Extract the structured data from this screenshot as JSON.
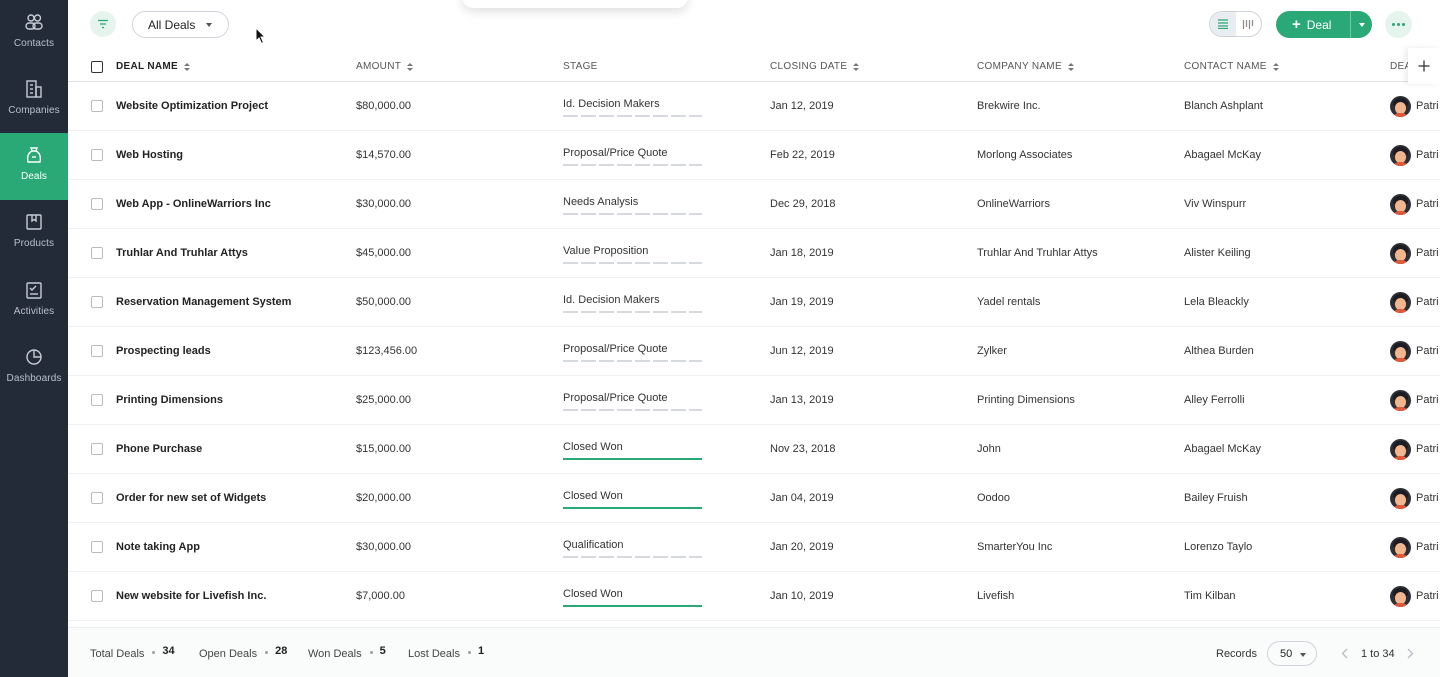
{
  "sidebar": {
    "items": [
      {
        "label": "Contacts",
        "icon": "contacts-icon",
        "active": false
      },
      {
        "label": "Companies",
        "icon": "companies-icon",
        "active": false
      },
      {
        "label": "Deals",
        "icon": "deals-icon",
        "active": true
      },
      {
        "label": "Products",
        "icon": "products-icon",
        "active": false
      },
      {
        "label": "Activities",
        "icon": "activities-icon",
        "active": false
      },
      {
        "label": "Dashboards",
        "icon": "dashboards-icon",
        "active": false
      }
    ]
  },
  "toolbar": {
    "view_label": "All Deals",
    "new_deal_label": "Deal"
  },
  "table": {
    "columns": {
      "deal_name": "DEAL NAME",
      "amount": "AMOUNT",
      "stage": "STAGE",
      "closing_date": "CLOSING DATE",
      "company_name": "COMPANY NAME",
      "contact_name": "CONTACT NAME",
      "deal_owner": "DEA"
    },
    "rows": [
      {
        "name": "Website Optimization Project",
        "amount": "$80,000.00",
        "stage": "Id. Decision Makers",
        "won": false,
        "date": "Jan 12, 2019",
        "company": "Brekwire Inc.",
        "contact": "Blanch Ashplant",
        "owner": "Patri"
      },
      {
        "name": "Web Hosting",
        "amount": "$14,570.00",
        "stage": "Proposal/Price Quote",
        "won": false,
        "date": "Feb 22, 2019",
        "company": "Morlong Associates",
        "contact": "Abagael McKay",
        "owner": "Patri"
      },
      {
        "name": "Web App - OnlineWarriors Inc",
        "amount": "$30,000.00",
        "stage": "Needs Analysis",
        "won": false,
        "date": "Dec 29, 2018",
        "company": "OnlineWarriors",
        "contact": "Viv Winspurr",
        "owner": "Patri"
      },
      {
        "name": "Truhlar And Truhlar Attys",
        "amount": "$45,000.00",
        "stage": "Value Proposition",
        "won": false,
        "date": "Jan 18, 2019",
        "company": "Truhlar And Truhlar Attys",
        "contact": "Alister Keiling",
        "owner": "Patri"
      },
      {
        "name": "Reservation Management System",
        "amount": "$50,000.00",
        "stage": "Id. Decision Makers",
        "won": false,
        "date": "Jan 19, 2019",
        "company": "Yadel rentals",
        "contact": "Lela Bleackly",
        "owner": "Patri"
      },
      {
        "name": "Prospecting leads",
        "amount": "$123,456.00",
        "stage": "Proposal/Price Quote",
        "won": false,
        "date": "Jun 12, 2019",
        "company": "Zylker",
        "contact": "Althea Burden",
        "owner": "Patri"
      },
      {
        "name": "Printing Dimensions",
        "amount": "$25,000.00",
        "stage": "Proposal/Price Quote",
        "won": false,
        "date": "Jan 13, 2019",
        "company": "Printing Dimensions",
        "contact": "Alley Ferrolli",
        "owner": "Patri"
      },
      {
        "name": "Phone Purchase",
        "amount": "$15,000.00",
        "stage": "Closed Won",
        "won": true,
        "date": "Nov 23, 2018",
        "company": "John",
        "contact": "Abagael McKay",
        "owner": "Patri"
      },
      {
        "name": "Order for new set of Widgets",
        "amount": "$20,000.00",
        "stage": "Closed Won",
        "won": true,
        "date": "Jan 04, 2019",
        "company": "Oodoo",
        "contact": "Bailey Fruish",
        "owner": "Patri"
      },
      {
        "name": "Note taking App",
        "amount": "$30,000.00",
        "stage": "Qualification",
        "won": false,
        "date": "Jan 20, 2019",
        "company": "SmarterYou Inc",
        "contact": "Lorenzo Taylo",
        "owner": "Patri"
      },
      {
        "name": "New website for Livefish Inc.",
        "amount": "$7,000.00",
        "stage": "Closed Won",
        "won": true,
        "date": "Jan 10, 2019",
        "company": "Livefish",
        "contact": "Tim Kilban",
        "owner": "Patri"
      }
    ]
  },
  "footer": {
    "stats": [
      {
        "label": "Total Deals",
        "value": "34"
      },
      {
        "label": "Open Deals",
        "value": "28"
      },
      {
        "label": "Won Deals",
        "value": "5"
      },
      {
        "label": "Lost Deals",
        "value": "1"
      }
    ],
    "records_label": "Records",
    "records_per_page": "50",
    "pagination": "1 to 34"
  },
  "colors": {
    "sidebar_bg": "#232a38",
    "accent": "#2aa876"
  }
}
